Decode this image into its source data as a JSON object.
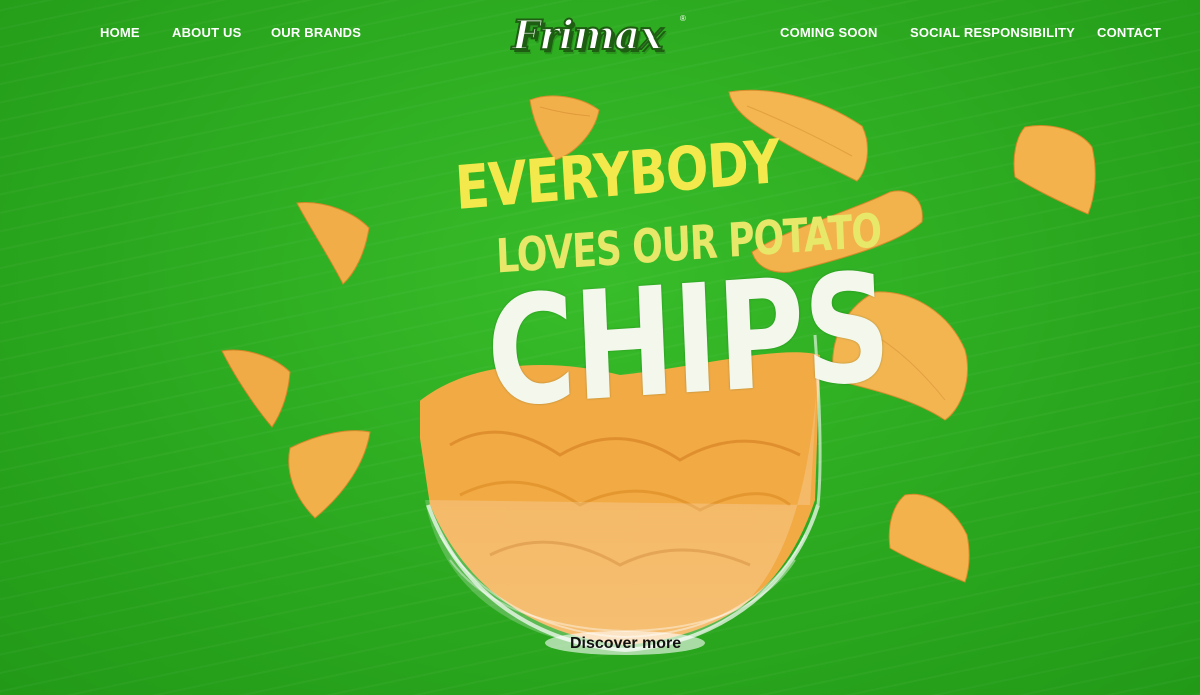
{
  "nav": {
    "left": [
      "HOME",
      "ABOUT US",
      "OUR BRANDS"
    ],
    "right": [
      "COMING SOON",
      "SOCIAL RESPONSIBILITY",
      "CONTACT"
    ]
  },
  "logo": {
    "text": "Frimax",
    "reg": "®"
  },
  "hero": {
    "line1": "EVERYBODY",
    "line2": "LOVES OUR POTATO",
    "line3": "CHIPS",
    "cta": "Discover more"
  },
  "colors": {
    "background": "#2eae22",
    "headline_yellow": "#f4e94c",
    "chip": "#f2b04a"
  }
}
